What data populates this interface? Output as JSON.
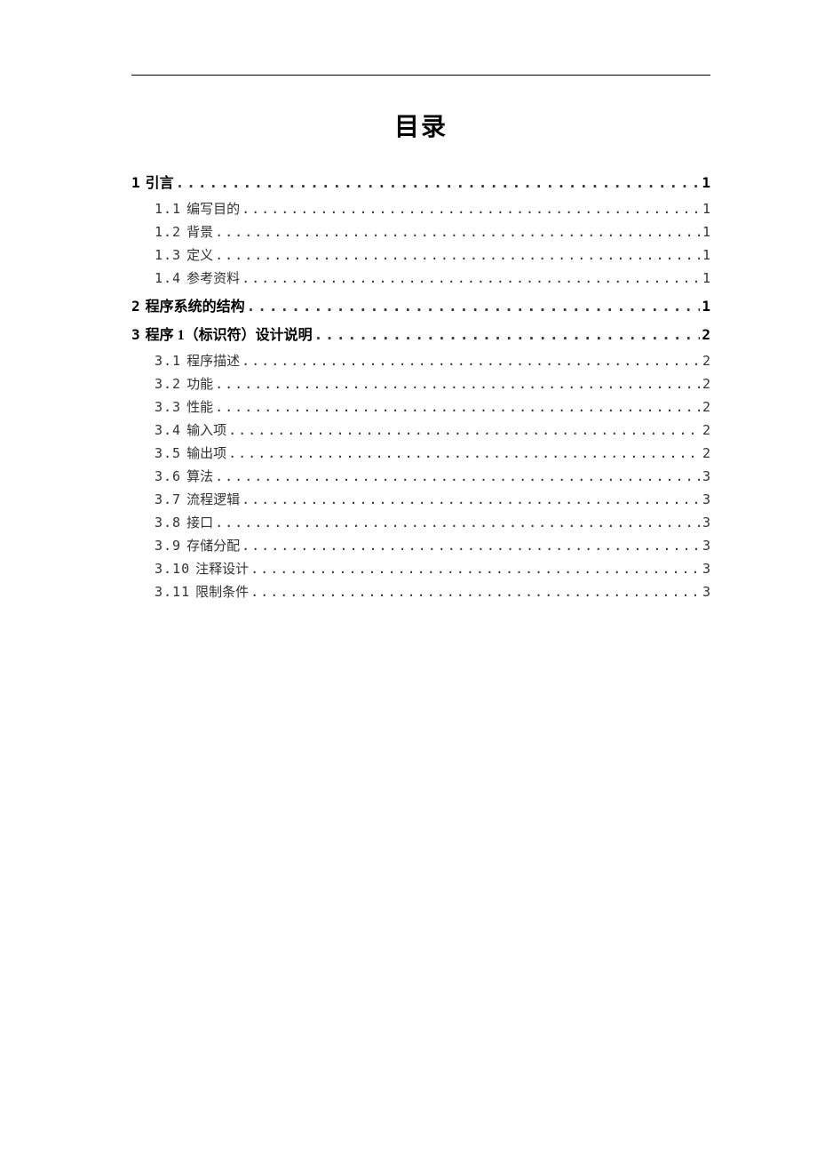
{
  "title": "目录",
  "entries": [
    {
      "level": 1,
      "num": "1",
      "text": "引言",
      "page": "1"
    },
    {
      "level": 2,
      "num": "1.1",
      "text": "编写目的",
      "page": "1"
    },
    {
      "level": 2,
      "num": "1.2",
      "text": "背景",
      "page": "1"
    },
    {
      "level": 2,
      "num": "1.3",
      "text": "定义",
      "page": "1"
    },
    {
      "level": 2,
      "num": "1.4",
      "text": "参考资料",
      "page": "1"
    },
    {
      "level": 1,
      "num": "2",
      "text": "程序系统的结构",
      "page": "1"
    },
    {
      "level": 1,
      "num": "3",
      "text": "程序 1（标识符）设计说明",
      "page": "2"
    },
    {
      "level": 2,
      "num": "3.1",
      "text": "程序描述",
      "page": "2"
    },
    {
      "level": 2,
      "num": "3.2",
      "text": "功能",
      "page": "2"
    },
    {
      "level": 2,
      "num": "3.3",
      "text": "性能",
      "page": "2"
    },
    {
      "level": 2,
      "num": "3.4",
      "text": "输入项",
      "page": "2"
    },
    {
      "level": 2,
      "num": "3.5",
      "text": "输出项",
      "page": "2"
    },
    {
      "level": 2,
      "num": "3.6",
      "text": "算法",
      "page": "3"
    },
    {
      "level": 2,
      "num": "3.7",
      "text": "流程逻辑",
      "page": "3"
    },
    {
      "level": 2,
      "num": "3.8",
      "text": "接口",
      "page": "3"
    },
    {
      "level": 2,
      "num": "3.9",
      "text": "存储分配",
      "page": "3"
    },
    {
      "level": 2,
      "num": "3.10",
      "text": "注释设计",
      "page": "3"
    },
    {
      "level": 2,
      "num": "3.11",
      "text": "限制条件",
      "page": "3"
    }
  ]
}
